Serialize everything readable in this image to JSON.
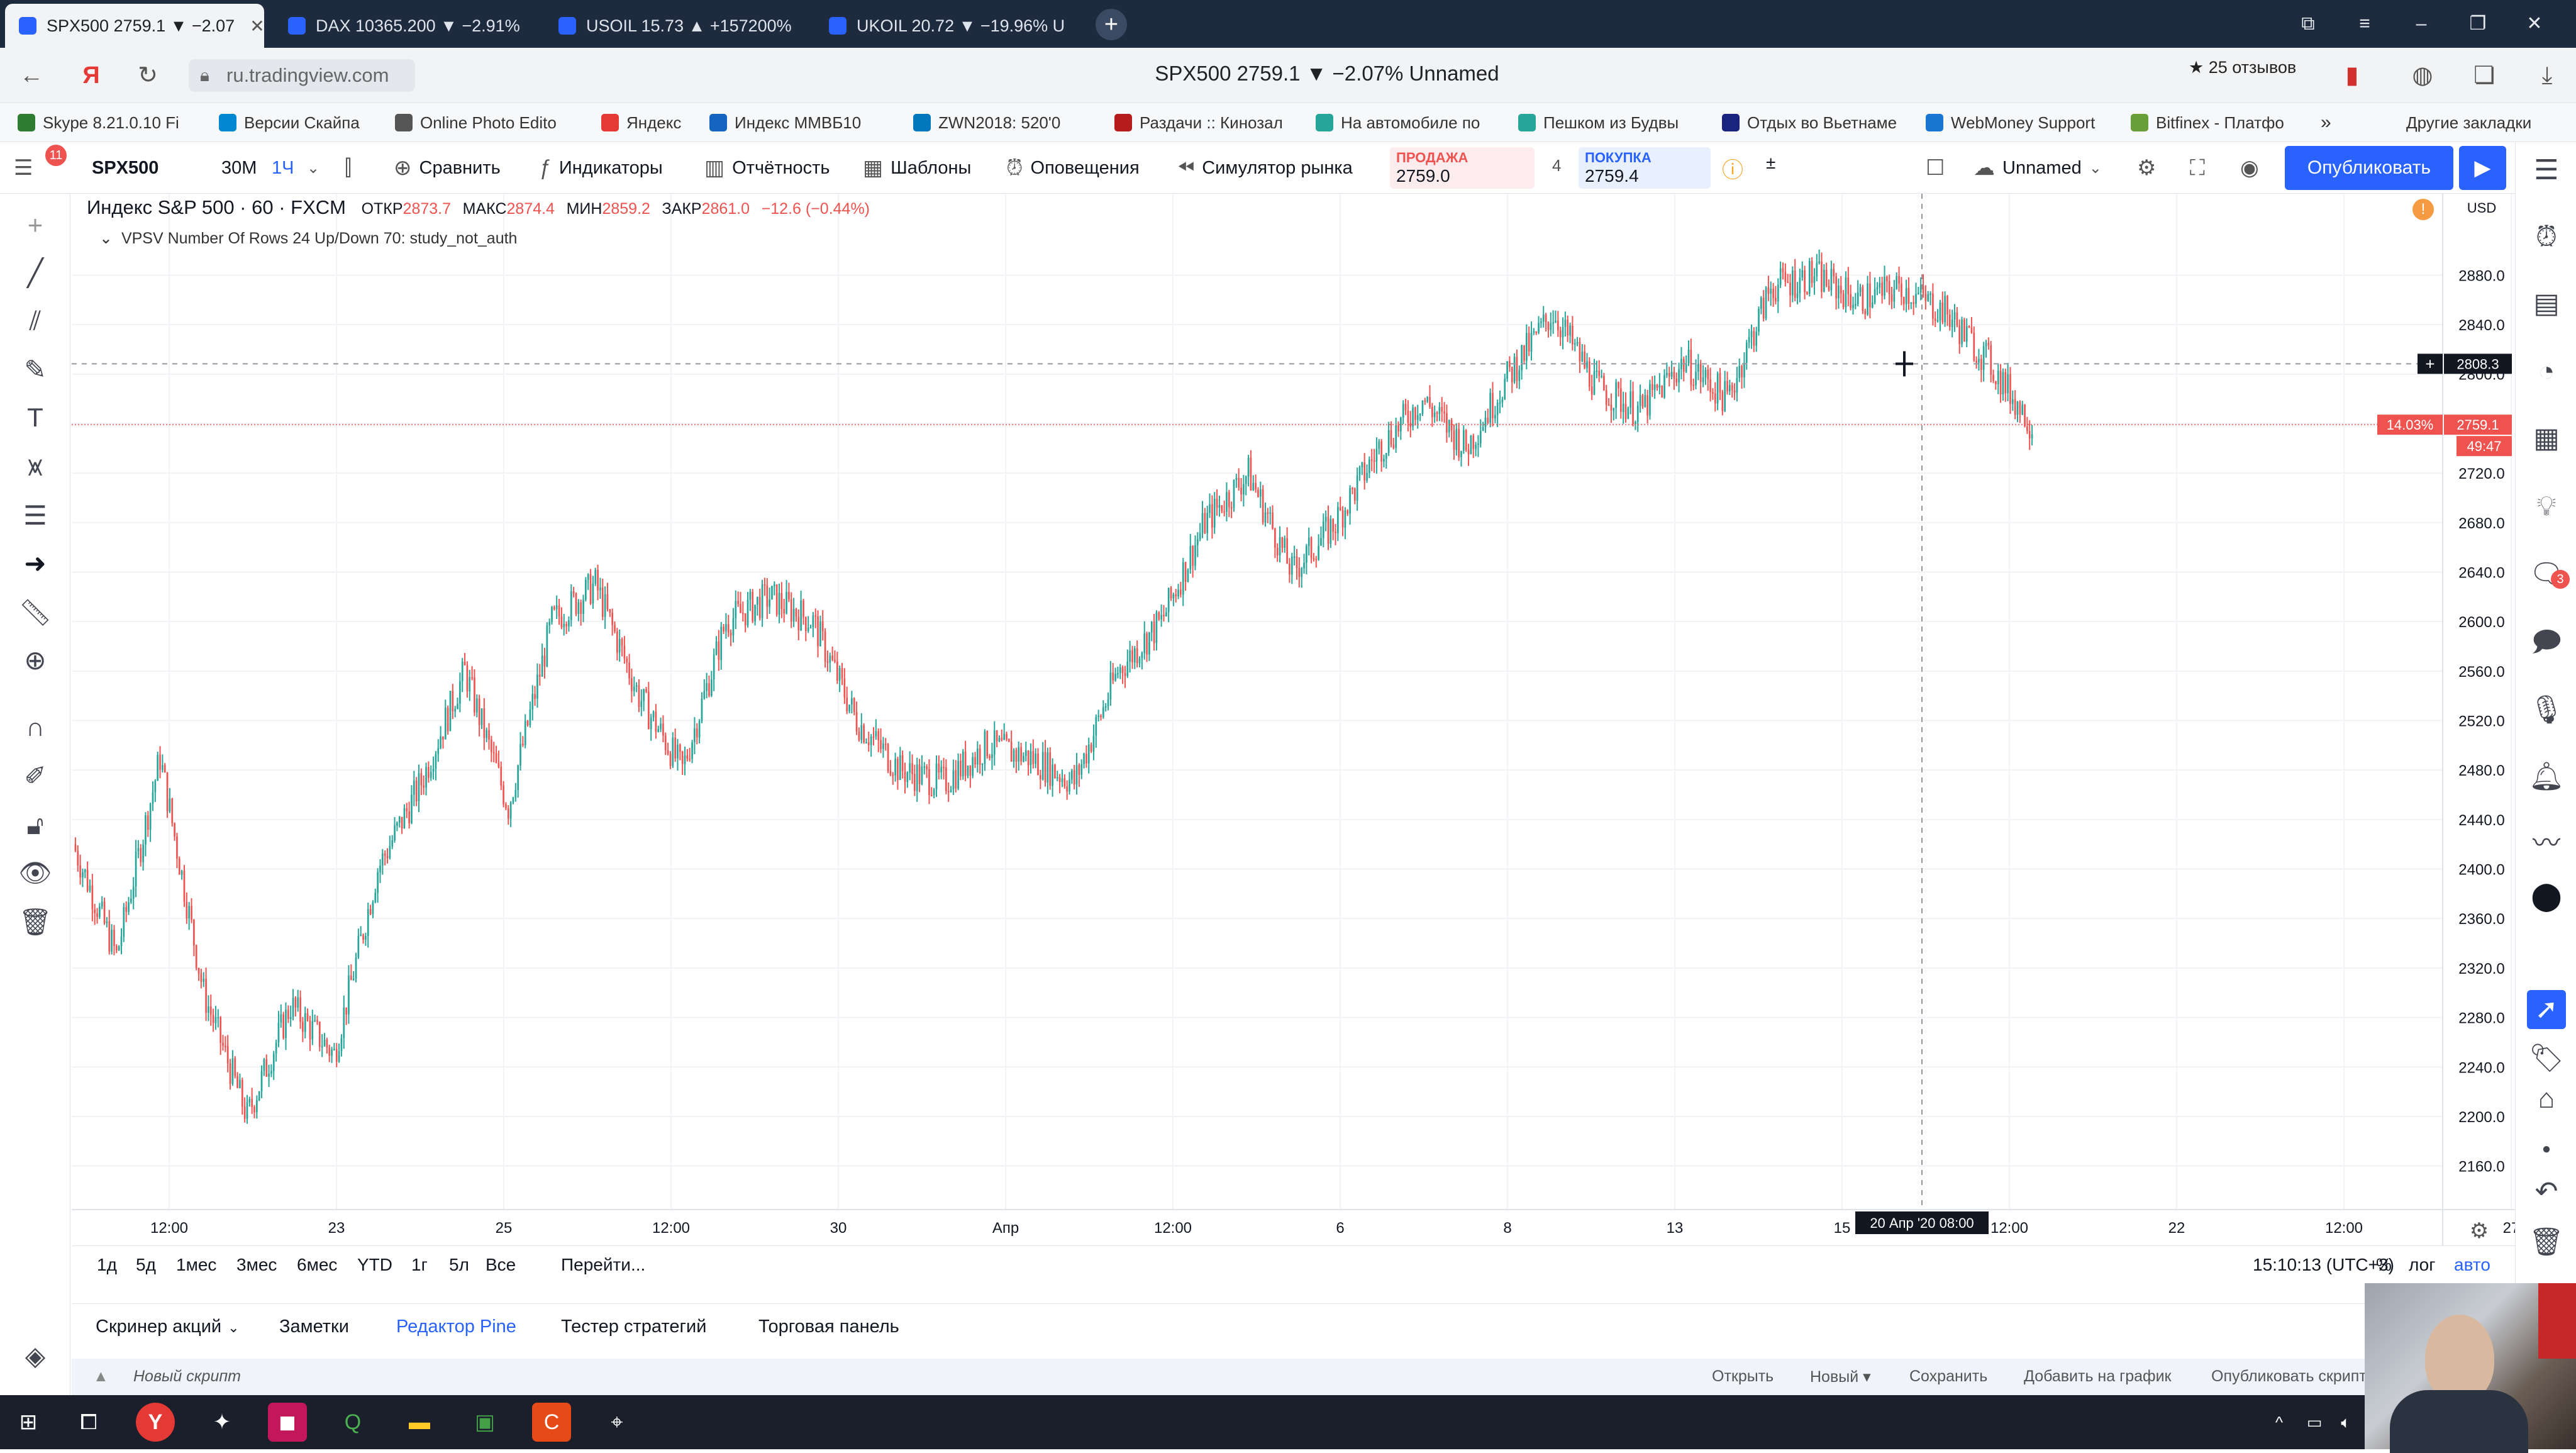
{
  "browser": {
    "tabs": [
      {
        "label": "SPX500 2759.1 ▼ −2.07",
        "active": true
      },
      {
        "label": "DAX 10365.200 ▼ −2.91%",
        "active": false
      },
      {
        "label": "USOIL 15.73 ▲ +157200%",
        "active": false
      },
      {
        "label": "UKOIL 20.72 ▼ −19.96% U",
        "active": false
      }
    ],
    "url": "ru.tradingview.com",
    "page_title": "SPX500 2759.1 ▼ −2.07% Unnamed",
    "reviews": "★ 25 отзывов",
    "bookmarks": [
      {
        "label": "Skype 8.21.0.10 Fi",
        "color": "#2e7d32"
      },
      {
        "label": "Версии Скайпа",
        "color": "#0288d1"
      },
      {
        "label": "Online Photo Edito",
        "color": "#555555"
      },
      {
        "label": "Яндекс",
        "color": "#e53935"
      },
      {
        "label": "Индекс ММВБ10",
        "color": "#1565c0"
      },
      {
        "label": "ZWN2018: 520'0",
        "color": "#0277bd"
      },
      {
        "label": "Раздачи :: Кинозал",
        "color": "#b71c1c"
      },
      {
        "label": "На автомобиле по",
        "color": "#26a69a"
      },
      {
        "label": "Пешком из Будвы",
        "color": "#26a69a"
      },
      {
        "label": "Отдых во Вьетнаме",
        "color": "#1a237e"
      },
      {
        "label": "WebMoney Support",
        "color": "#1976d2"
      },
      {
        "label": "Bitfinex - Платфо",
        "color": "#689f38"
      },
      {
        "label": "Другие закладки",
        "color": ""
      }
    ]
  },
  "toolbar": {
    "symbol": "SPX500",
    "interval_30m": "30М",
    "interval_1h": "1Ч",
    "compare": "Сравнить",
    "indicators": "Индикаторы",
    "financials": "Отчётность",
    "templates": "Шаблоны",
    "alerts": "Оповещения",
    "replay": "Симулятор рынка",
    "sell_label": "ПРОДАЖА",
    "sell_price": "2759.0",
    "spread": "4",
    "buy_label": "ПОКУПКА",
    "buy_price": "2759.4",
    "layout_name": "Unnamed",
    "publish": "Опубликовать"
  },
  "legend": {
    "title": "Индекс S&P 500 · 60 · FXCM",
    "o_label": "ОТКР",
    "o": "2873.7",
    "h_label": "МАКС",
    "h": "2874.4",
    "l_label": "МИН",
    "l": "2859.2",
    "c_label": "ЗАКР",
    "c": "2861.0",
    "change": "−12.6 (−0.44%)",
    "indicator": "VPSV Number Of Rows 24 Up/Down 70: study_not_auth"
  },
  "chart_data": {
    "type": "candlestick",
    "currency": "USD",
    "ylim": [
      2140,
      2900
    ],
    "y_ticks": [
      2160,
      2200,
      2240,
      2280,
      2320,
      2360,
      2400,
      2440,
      2480,
      2520,
      2560,
      2600,
      2640,
      2680,
      2720,
      2760,
      2800,
      2840,
      2880
    ],
    "x_ticks": [
      "12:00",
      "23",
      "25",
      "12:00",
      "30",
      "Апр",
      "12:00",
      "6",
      "8",
      "13",
      "15",
      "12:00",
      "22",
      "12:00",
      "27"
    ],
    "crosshair_date_label": "20 Апр '20  08:00",
    "crosshair_price": "2808.3",
    "last_price": "2759.1",
    "last_price_pct": "14.03%",
    "countdown": "49:47",
    "up_color": "#26a69a",
    "down_color": "#ef5350",
    "price_path": [
      {
        "t": "Mar 20",
        "v": 2420
      },
      {
        "t": "Mar 20 12:00",
        "v": 2330
      },
      {
        "t": "Mar 21",
        "v": 2490
      },
      {
        "t": "Mar 22",
        "v": 2300
      },
      {
        "t": "Mar 23",
        "v": 2200
      },
      {
        "t": "Mar 23 12:00",
        "v": 2290
      },
      {
        "t": "Mar 24",
        "v": 2250
      },
      {
        "t": "Mar 24 12:00",
        "v": 2400
      },
      {
        "t": "Mar 25",
        "v": 2470
      },
      {
        "t": "Mar 25 12:00",
        "v": 2560
      },
      {
        "t": "Mar 26",
        "v": 2450
      },
      {
        "t": "Mar 26 12:00",
        "v": 2600
      },
      {
        "t": "Mar 27",
        "v": 2630
      },
      {
        "t": "Mar 27 12:00",
        "v": 2540
      },
      {
        "t": "Mar 30",
        "v": 2480
      },
      {
        "t": "Mar 30 12:00",
        "v": 2600
      },
      {
        "t": "Mar 31",
        "v": 2620
      },
      {
        "t": "Mar 31 12:00",
        "v": 2600
      },
      {
        "t": "Apr 1",
        "v": 2520
      },
      {
        "t": "Apr 1 12:00",
        "v": 2480
      },
      {
        "t": "Apr 2",
        "v": 2470
      },
      {
        "t": "Apr 2 12:00",
        "v": 2500
      },
      {
        "t": "Apr 3",
        "v": 2490
      },
      {
        "t": "Apr 3 12:00",
        "v": 2470
      },
      {
        "t": "Apr 6",
        "v": 2560
      },
      {
        "t": "Apr 6 12:00",
        "v": 2600
      },
      {
        "t": "Apr 7",
        "v": 2680
      },
      {
        "t": "Apr 7 12:00",
        "v": 2720
      },
      {
        "t": "Apr 8",
        "v": 2640
      },
      {
        "t": "Apr 8 12:00",
        "v": 2680
      },
      {
        "t": "Apr 9",
        "v": 2740
      },
      {
        "t": "Apr 13",
        "v": 2780
      },
      {
        "t": "Apr 13 12:00",
        "v": 2740
      },
      {
        "t": "Apr 14",
        "v": 2800
      },
      {
        "t": "Apr 14 12:00",
        "v": 2850
      },
      {
        "t": "Apr 15",
        "v": 2790
      },
      {
        "t": "Apr 15 12:00",
        "v": 2770
      },
      {
        "t": "Apr 16",
        "v": 2810
      },
      {
        "t": "Apr 16 12:00",
        "v": 2780
      },
      {
        "t": "Apr 17",
        "v": 2870
      },
      {
        "t": "Apr 17 12:00",
        "v": 2880
      },
      {
        "t": "Apr 17 18:00",
        "v": 2860
      },
      {
        "t": "Apr 20",
        "v": 2870
      },
      {
        "t": "Apr 20 08:00",
        "v": 2850
      },
      {
        "t": "Apr 20 12:00",
        "v": 2810
      },
      {
        "t": "Apr 20 18:00",
        "v": 2759
      }
    ]
  },
  "range_bar": {
    "ranges": [
      "1д",
      "5д",
      "1мес",
      "3мес",
      "6мес",
      "YTD",
      "1г",
      "5л",
      "Все"
    ],
    "goto": "Перейти...",
    "time": "15:10:13 (UTC+3)",
    "pct": "%",
    "log": "лог",
    "auto": "авто"
  },
  "panel_tabs": [
    "Скринер акций",
    "Заметки",
    "Редактор Pine",
    "Тестер стратегий",
    "Торговая панель"
  ],
  "script_bar": {
    "title": "Новый скрипт",
    "open": "Открыть",
    "new": "Новый ▾",
    "save": "Сохранить",
    "add_to_chart": "Добавить на график",
    "publish_script": "Опубликовать скрипт"
  },
  "notifications_badge": "11",
  "chat_badge": "3"
}
